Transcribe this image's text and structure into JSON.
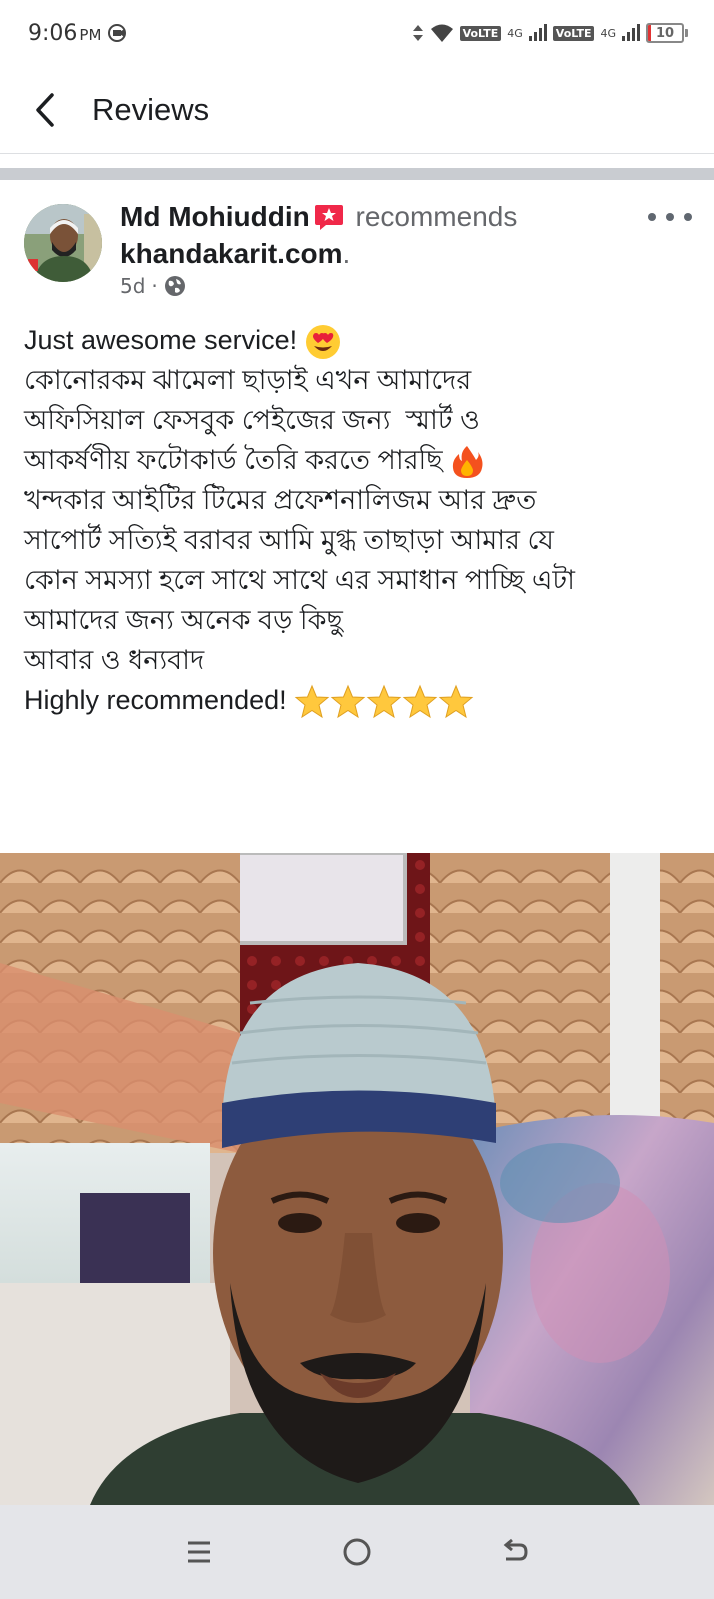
{
  "status_bar": {
    "time": "9:06",
    "ampm": "PM",
    "network1": "VoLTE",
    "net1_type": "4G",
    "network2": "VoLTE",
    "net2_type": "4G",
    "battery_level": "10",
    "battery_fraction": 0.1,
    "icons": [
      "screen-record-icon",
      "data-arrows-icon",
      "wifi-icon",
      "signal-icon",
      "battery-icon"
    ]
  },
  "header": {
    "back_icon": "back-arrow-icon",
    "title": "Reviews"
  },
  "post": {
    "author": "Md Mohiuddin",
    "verb": "recommends",
    "page": "khandakarit.com",
    "period": ".",
    "time_ago": "5d",
    "separator": "·",
    "audience_icon": "globe-icon",
    "more_icon": "more-options-icon",
    "text_lines": [
      "Just awesome service!",
      "কোনোরকম ঝামেলা ছাড়াই এখন আমাদের",
      "অফিসিয়াল ফেসবুক পেইজের জন্য  স্মার্ট ও",
      "আকর্ষণীয় ফটোকার্ড তৈরি করতে পারছি",
      "",
      "খন্দকার আইটির টিমের প্রফেশনালিজম আর দ্রুত",
      "সাপোর্ট সত্যিই বরাবর আমি মুগ্ধ তাছাড়া আমার যে",
      "কোন সমস্যা হলে সাথে সাথে এর সমাধান পাচ্ছি এটা",
      "আমাদের জন্য অনেক বড় কিছু",
      "আবার ও ধন্যবাদ",
      "Highly recommended!"
    ],
    "emoji": {
      "line1": "heart-eyes-emoji",
      "line4": "fire-emoji",
      "last": "five-stars-emoji"
    },
    "star_count": 5
  },
  "navbar": {
    "menu_icon": "recent-apps-icon",
    "home_icon": "home-icon",
    "back_icon": "back-gesture-icon"
  },
  "colors": {
    "text": "#1c1e21",
    "secondary": "#65676b",
    "divider": "#c9ccd1",
    "navbar": "#e4e5e9",
    "recommend_badge": "#f02849"
  }
}
